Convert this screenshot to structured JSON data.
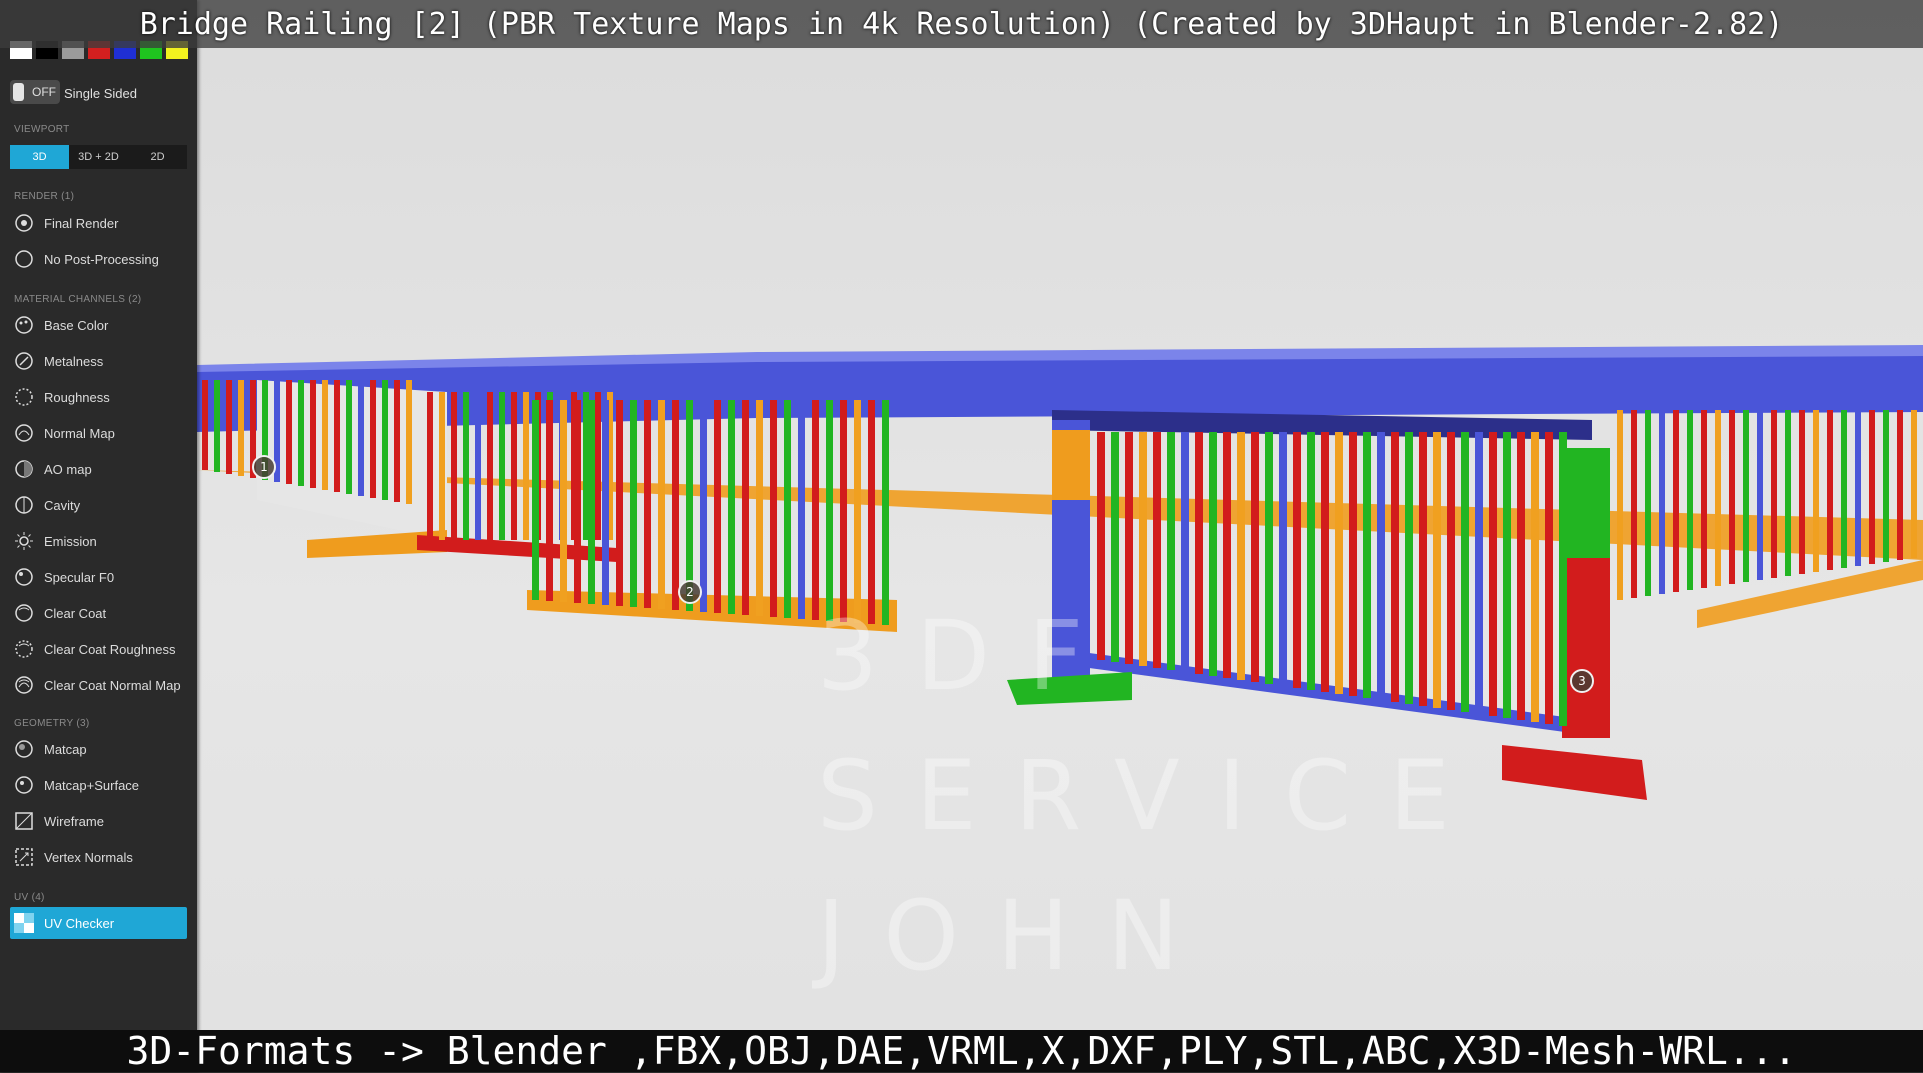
{
  "title_caption": "Bridge Railing [2] (PBR Texture Maps in 4k Resolution) (Created by 3DHaupt in Blender-2.82)",
  "formats_caption": "3D-Formats -> Blender ,FBX,OBJ,DAE,VRML,X,DXF,PLY,STL,ABC,X3D-Mesh-WRL...",
  "sidebar": {
    "swatch_colors": [
      "#ffffff",
      "#000000",
      "#9b9b9b",
      "#d41f1f",
      "#1f2fd4",
      "#1fc41f",
      "#f2f21f"
    ],
    "toggle": {
      "state": "OFF",
      "label": "Single Sided"
    },
    "viewport": {
      "label": "VIEWPORT",
      "options": [
        "3D",
        "3D + 2D",
        "2D"
      ],
      "active": "3D"
    },
    "render": {
      "label": "RENDER (1)",
      "items": [
        "Final Render",
        "No Post-Processing"
      ]
    },
    "material": {
      "label": "MATERIAL CHANNELS (2)",
      "items": [
        "Base Color",
        "Metalness",
        "Roughness",
        "Normal Map",
        "AO map",
        "Cavity",
        "Emission",
        "Specular F0",
        "Clear Coat",
        "Clear Coat Roughness",
        "Clear Coat Normal Map"
      ]
    },
    "geometry": {
      "label": "GEOMETRY (3)",
      "items": [
        "Matcap",
        "Matcap+Surface",
        "Wireframe",
        "Vertex Normals"
      ]
    },
    "uv": {
      "label": "UV (4)",
      "items": [
        "UV Checker"
      ]
    }
  },
  "viewport": {
    "hotspots": [
      "1",
      "2",
      "3"
    ],
    "watermark": [
      "3DF",
      "SERVICE",
      "JOHN"
    ]
  },
  "colors": {
    "accent": "#1fa7d6",
    "blue": "#4a55d8",
    "red": "#d21c1c",
    "green": "#22b522",
    "orange": "#f0a020"
  }
}
